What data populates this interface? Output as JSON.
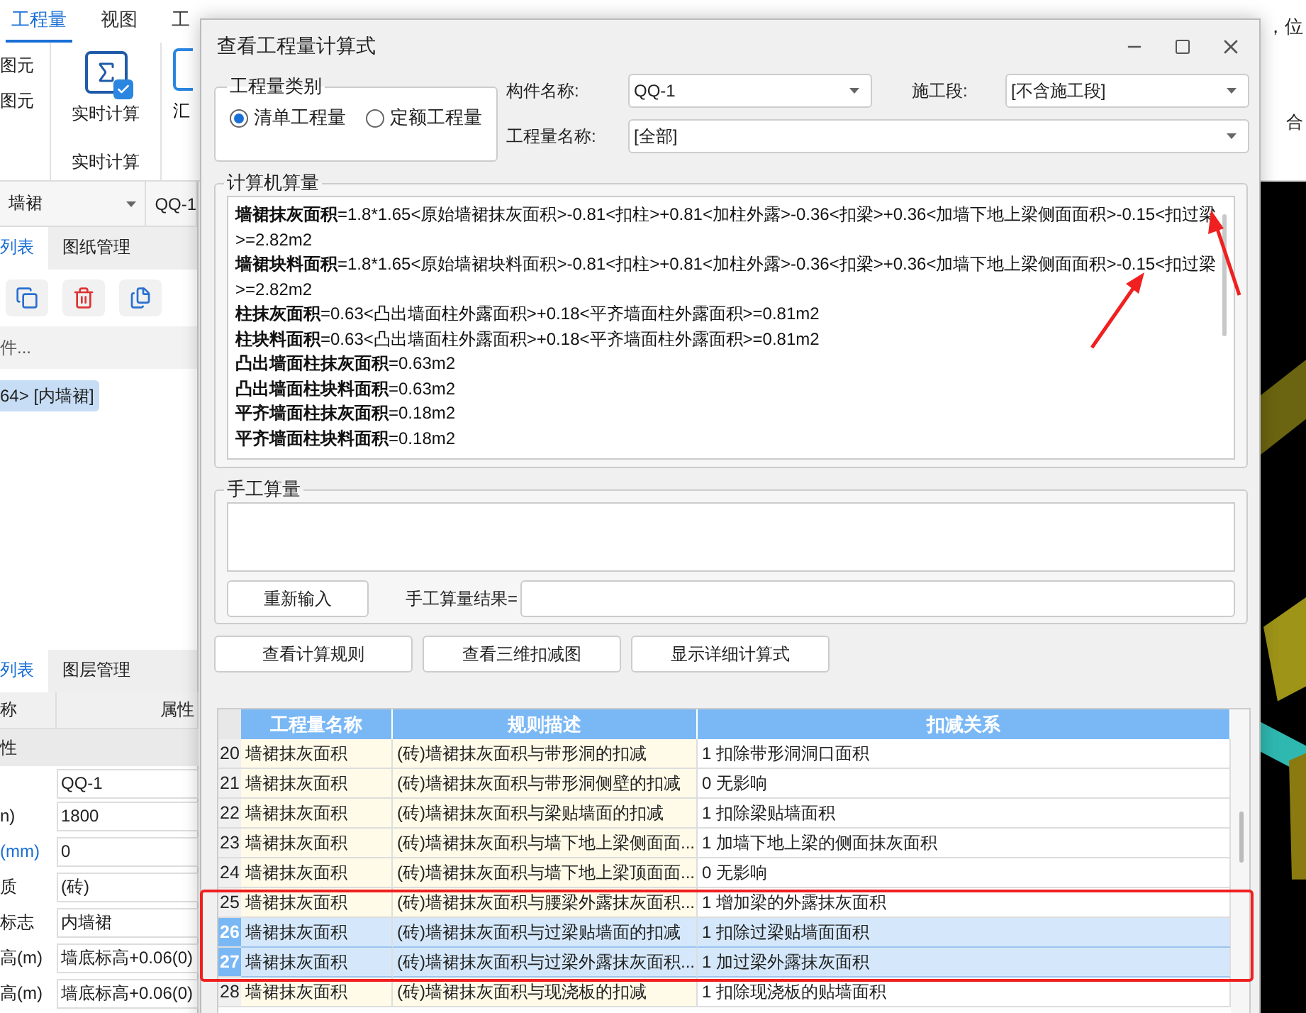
{
  "menu_tabs": [
    {
      "label": "工程量",
      "selected": true
    },
    {
      "label": "视图",
      "selected": false
    },
    {
      "label": "工",
      "selected": false
    }
  ],
  "top_right_text": "，位",
  "ribbon": {
    "side_items": [
      "图元",
      "图元"
    ],
    "realtime_button": "实时计算",
    "group_label": "实时计算",
    "partial_button": "汇",
    "right_text": "合"
  },
  "selector_bar": {
    "type": "墙裙",
    "name": "QQ-1"
  },
  "panel_tabs": [
    {
      "label": "列表",
      "selected": true
    },
    {
      "label": "图纸管理",
      "selected": false
    }
  ],
  "search": {
    "placeholder": "件..."
  },
  "tree": [
    {
      "label": "64> [内墙裙]",
      "selected": true
    }
  ],
  "property_tabs": [
    {
      "label": "列表",
      "selected": true
    },
    {
      "label": "图层管理",
      "selected": false
    }
  ],
  "properties": {
    "columns": [
      "称",
      "属性"
    ],
    "rows": [
      {
        "kind": "group",
        "name": "性"
      },
      {
        "kind": "row",
        "value": "QQ-1"
      },
      {
        "kind": "row",
        "name": "n)",
        "value": "1800"
      },
      {
        "kind": "linked",
        "name": "(mm)",
        "value": "0"
      },
      {
        "kind": "row",
        "name": "质",
        "value": "(砖)"
      },
      {
        "kind": "row",
        "name": "标志",
        "value": "内墙裙"
      },
      {
        "kind": "row",
        "name": "高(m)",
        "value": "墙底标高+0.06(0)"
      },
      {
        "kind": "row",
        "name": "高(m)",
        "value": "墙底标高+0.06(0)"
      }
    ]
  },
  "dialog": {
    "title": "查看工程量计算式",
    "category": {
      "legend": "工程量类别",
      "options": [
        {
          "label": "清单工程量",
          "selected": true
        },
        {
          "label": "定额工程量",
          "selected": false
        }
      ]
    },
    "component": {
      "label": "构件名称:",
      "value": "QQ-1"
    },
    "stage": {
      "label": "施工段:",
      "value": "[不含施工段]"
    },
    "quantity": {
      "label": "工程量名称:",
      "value": "[全部]"
    },
    "computer": {
      "legend": "计算机算量",
      "lines": [
        "**墙裙抹灰面积**=1.8*1.65<原始墙裙抹灰面积>-0.81<扣柱>+0.81<加柱外露>-0.36<扣梁>+0.36<加墙下地上梁侧面面积>-0.15<扣过梁>=2.82m2",
        "**墙裙块料面积**=1.8*1.65<原始墙裙块料面积>-0.81<扣柱>+0.81<加柱外露>-0.36<扣梁>+0.36<加墙下地上梁侧面面积>-0.15<扣过梁>=2.82m2",
        "**柱抹灰面积**=0.63<凸出墙面柱外露面积>+0.18<平齐墙面柱外露面积>=0.81m2",
        "**柱块料面积**=0.63<凸出墙面柱外露面积>+0.18<平齐墙面柱外露面积>=0.81m2",
        "**凸出墙面柱抹灰面积**=0.63m2",
        "**凸出墙面柱块料面积**=0.63m2",
        "**平齐墙面柱抹灰面积**=0.18m2",
        "**平齐墙面柱块料面积**=0.18m2"
      ]
    },
    "manual": {
      "legend": "手工算量",
      "reset_button": "重新输入",
      "result_label": "手工算量结果="
    },
    "buttons": [
      "查看计算规则",
      "查看三维扣减图",
      "显示详细计算式"
    ],
    "table": {
      "columns": [
        "工程量名称",
        "规则描述",
        "扣减关系"
      ],
      "rows": [
        {
          "num": "20",
          "name": "墙裙抹灰面积",
          "rule": "(砖)墙裙抹灰面积与带形洞的扣减",
          "relation": "1 扣除带形洞洞口面积",
          "selected": false
        },
        {
          "num": "21",
          "name": "墙裙抹灰面积",
          "rule": "(砖)墙裙抹灰面积与带形洞侧壁的扣减",
          "relation": "0  无影响",
          "selected": false
        },
        {
          "num": "22",
          "name": "墙裙抹灰面积",
          "rule": "(砖)墙裙抹灰面积与梁贴墙面的扣减",
          "relation": "1 扣除梁贴墙面积",
          "selected": false
        },
        {
          "num": "23",
          "name": "墙裙抹灰面积",
          "rule": "(砖)墙裙抹灰面积与墙下地上梁侧面面...",
          "relation": "1 加墙下地上梁的侧面抹灰面积",
          "selected": false
        },
        {
          "num": "24",
          "name": "墙裙抹灰面积",
          "rule": "(砖)墙裙抹灰面积与墙下地上梁顶面面...",
          "relation": "0  无影响",
          "selected": false
        },
        {
          "num": "25",
          "name": "墙裙抹灰面积",
          "rule": "(砖)墙裙抹灰面积与腰梁外露抹灰面积...",
          "relation": "1 增加梁的外露抹灰面积",
          "selected": false
        },
        {
          "num": "26",
          "name": "墙裙抹灰面积",
          "rule": "(砖)墙裙抹灰面积与过梁贴墙面的扣减",
          "relation": "1 扣除过梁贴墙面面积",
          "selected": true
        },
        {
          "num": "27",
          "name": "墙裙抹灰面积",
          "rule": "(砖)墙裙抹灰面积与过梁外露抹灰面积...",
          "relation": "1 加过梁外露抹灰面积",
          "selected": true
        },
        {
          "num": "28",
          "name": "墙裙抹灰面积",
          "rule": "(砖)墙裙抹灰面积与现浇板的扣减",
          "relation": "1 扣除现浇板的贴墙面积",
          "selected": false
        }
      ]
    }
  }
}
